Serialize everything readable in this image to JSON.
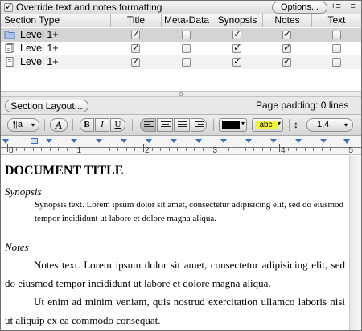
{
  "top_bar": {
    "override_label": "Override text and notes formatting",
    "override_checked": true,
    "options_label": "Options..."
  },
  "table": {
    "columns": [
      "Section Type",
      "Title",
      "Meta-Data",
      "Synopsis",
      "Notes",
      "Text"
    ],
    "rows": [
      {
        "icon": "folder-icon",
        "label": "Level  1+",
        "title": true,
        "metadata": false,
        "synopsis": true,
        "notes": true,
        "text": false
      },
      {
        "icon": "stack-document-icon",
        "label": "Level  1+",
        "title": true,
        "metadata": false,
        "synopsis": true,
        "notes": true,
        "text": false
      },
      {
        "icon": "document-icon",
        "label": "Level  1+",
        "title": true,
        "metadata": false,
        "synopsis": true,
        "notes": true,
        "text": false
      }
    ]
  },
  "layout_bar": {
    "section_layout_label": "Section Layout...",
    "page_padding": "Page padding: 0 lines"
  },
  "format_toolbar": {
    "paragraph_style_glyph": "¶a",
    "font_glyph": "A",
    "bold": "B",
    "italic": "I",
    "underline": "U",
    "highlight_label": "abc",
    "line_spacing": "1.4",
    "text_color": "#000000",
    "highlight_color": "#f2f237"
  },
  "ruler": {
    "numbers": [
      "0",
      "1",
      "2",
      "3",
      "4",
      "5"
    ]
  },
  "document": {
    "title": "DOCUMENT TITLE",
    "synopsis_label": "Synopsis",
    "synopsis_text": "Synopsis text. Lorem ipsum dolor sit amet, consectetur adipisicing elit, sed do eiusmod tempor incididunt ut labore et dolore magna aliqua.",
    "notes_label": "Notes",
    "notes_p1": "Notes text. Lorem ipsum dolor sit amet, consectetur adipisicing elit, sed do eiusmod tempor incididunt ut labore et dolore magna aliqua.",
    "notes_p2": "Ut enim ad minim veniam, quis nostrud exercitation ullamco laboris nisi ut aliquip ex ea commodo consequat."
  }
}
